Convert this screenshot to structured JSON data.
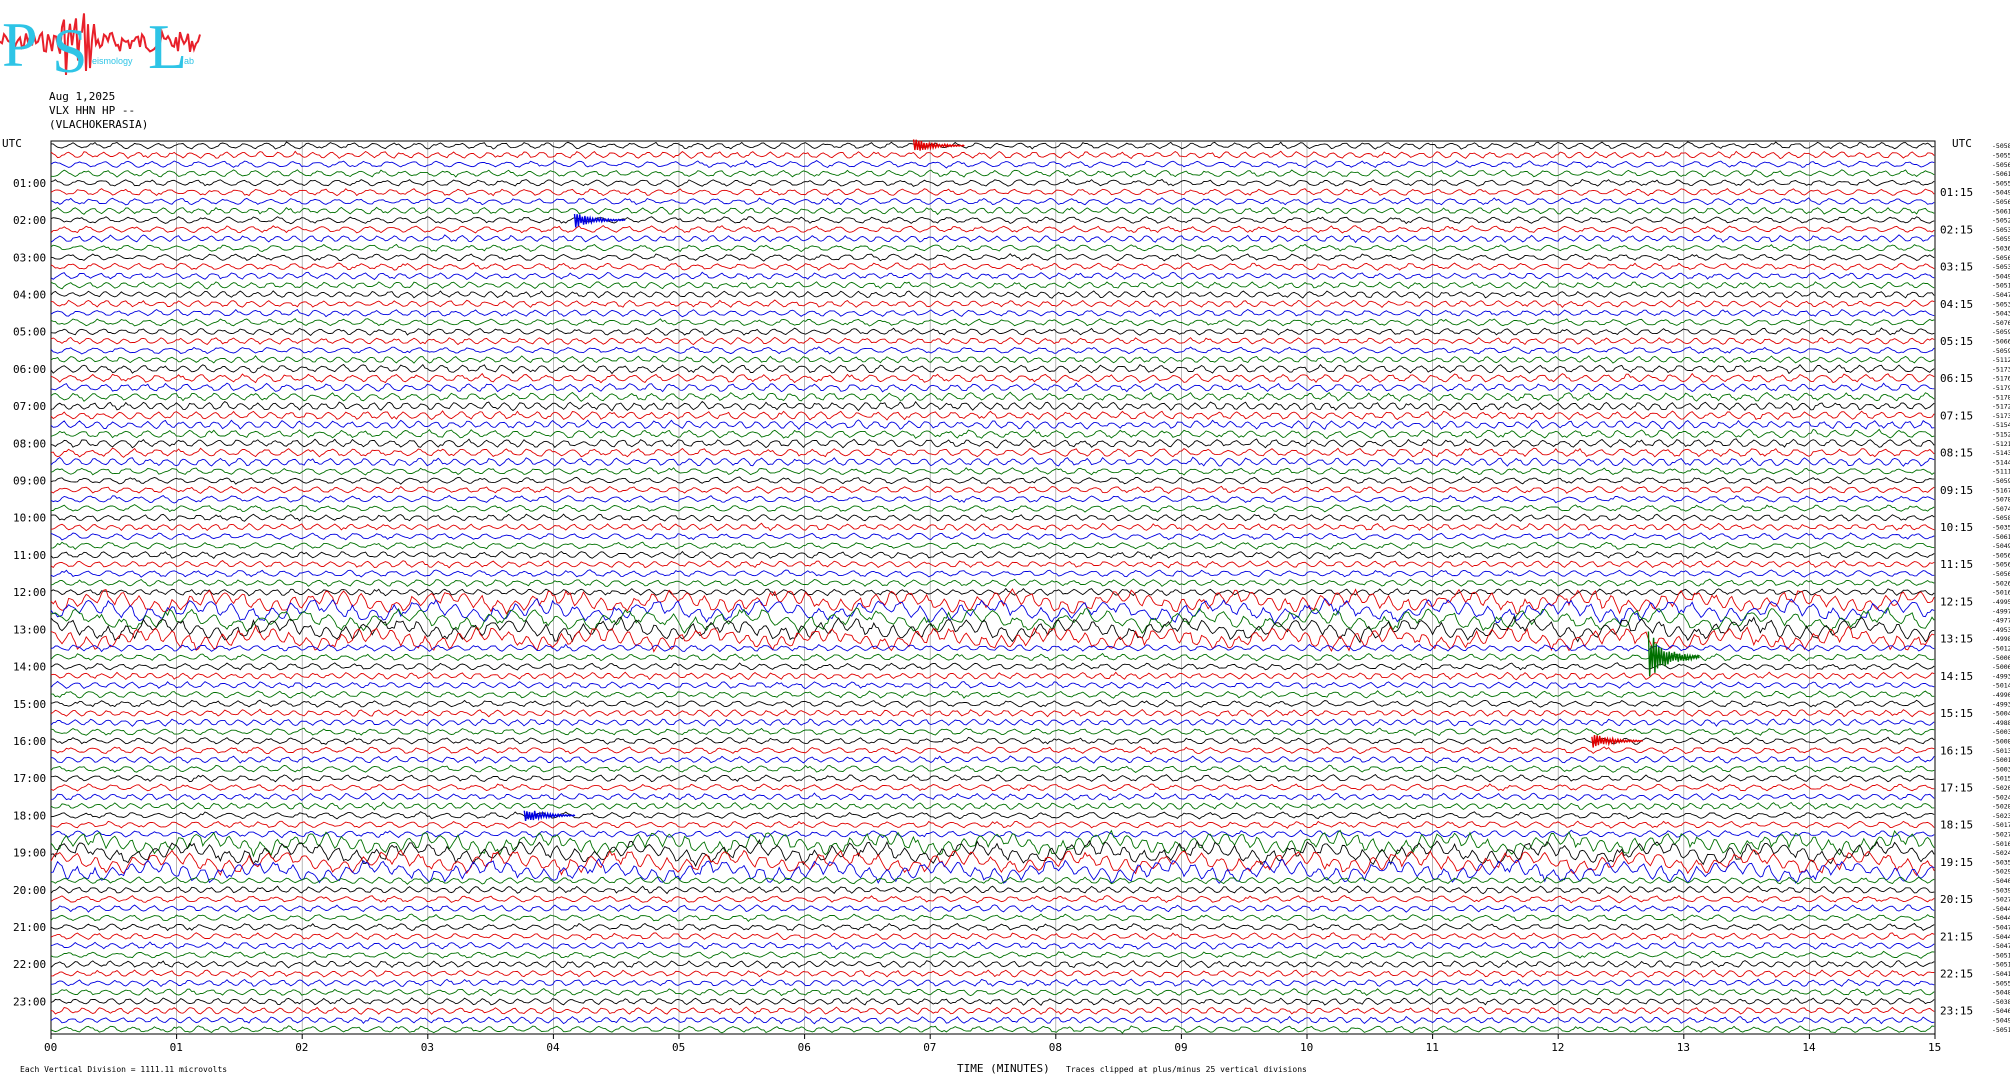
{
  "logo": {
    "letters": "PSL",
    "small_text": [
      "eismology",
      "ab"
    ],
    "colors": {
      "letters": "#2ec4e6",
      "wave": "#e8202a"
    }
  },
  "header": {
    "date": "Aug 1,2025",
    "channel": "VLX HHN HP --",
    "station": "(VLACHOKERASIA)"
  },
  "axis": {
    "left_title": "UTC",
    "right_title": "UTC",
    "left_labels": [
      "01:00",
      "02:00",
      "03:00",
      "04:00",
      "05:00",
      "06:00",
      "07:00",
      "08:00",
      "09:00",
      "10:00",
      "11:00",
      "12:00",
      "13:00",
      "14:00",
      "15:00",
      "16:00",
      "17:00",
      "18:00",
      "19:00",
      "20:00",
      "21:00",
      "22:00",
      "23:00"
    ],
    "right_labels": [
      "01:15",
      "02:15",
      "03:15",
      "04:15",
      "05:15",
      "06:15",
      "07:15",
      "08:15",
      "09:15",
      "10:15",
      "11:15",
      "12:15",
      "13:15",
      "14:15",
      "15:15",
      "16:15",
      "17:15",
      "18:15",
      "19:15",
      "20:15",
      "21:15",
      "22:15",
      "23:15"
    ],
    "x_ticks": [
      "00",
      "01",
      "02",
      "03",
      "04",
      "05",
      "06",
      "07",
      "08",
      "09",
      "10",
      "11",
      "12",
      "13",
      "14",
      "15"
    ],
    "x_title": "TIME (MINUTES)"
  },
  "footer": {
    "scale_note": "Each Vertical Division = 1111.11 microvolts",
    "clip_note": "Traces clipped at plus/minus 25 vertical divisions"
  },
  "trace_colors": [
    "#000000",
    "#e00000",
    "#0000e0",
    "#007000"
  ],
  "chart_data": {
    "type": "line",
    "title": "Aug 1,2025 VLX HHN HP -- (VLACHOKERASIA)",
    "xlabel": "TIME (MINUTES)",
    "ylabel": "UTC",
    "xlim": [
      0,
      15
    ],
    "rows": 96,
    "minutes_per_row": 15,
    "trace_colors_cycle": [
      "black",
      "red",
      "blue",
      "green"
    ],
    "row_values": [
      "-5058",
      "-5055",
      "-5056",
      "-5061",
      "-5055",
      "-5049",
      "-5056",
      "-5061",
      "-5052",
      "-5053",
      "-5055",
      "-5036",
      "-5056",
      "-5053",
      "-5049",
      "-5051",
      "-5047",
      "-5053",
      "-5043",
      "-5076",
      "-5059",
      "-5066",
      "-5059",
      "-5112",
      "-5173",
      "-5176",
      "-5179",
      "-5178",
      "-5172",
      "-5173",
      "-5154",
      "-5152",
      "-5121",
      "-5143",
      "-5144",
      "-5111",
      "-5059",
      "-5167",
      "-5078",
      "-5074",
      "-5058",
      "-5035",
      "-5061",
      "-5049",
      "-5056",
      "-5056",
      "-5056",
      "-5026",
      "-5016",
      "-4995",
      "-4997",
      "-4977",
      "-4953",
      "-4998",
      "-5012",
      "-5000",
      "-5006",
      "-4993",
      "-5014",
      "-4990",
      "-4993",
      "-5004",
      "-4988",
      "-5003",
      "-5008",
      "-5013",
      "-5001",
      "-5003",
      "-5015",
      "-5020",
      "-5024",
      "-5028",
      "-5023",
      "-5017",
      "-5027",
      "-5016",
      "-5024",
      "-5035",
      "-5029",
      "-5040",
      "-5039",
      "-5027",
      "-5044",
      "-5044",
      "-5047",
      "-5044",
      "-5047",
      "-5051",
      "-5051",
      "-5041",
      "-5055",
      "-5048",
      "-5038",
      "-5046",
      "-5049",
      "-5051"
    ],
    "events": [
      {
        "utc_row_start": "00:00",
        "minute": 6.9,
        "color": "red"
      },
      {
        "utc_row_start": "02:00",
        "minute": 4.2,
        "color": "blue"
      },
      {
        "utc_row_start": "13:45",
        "minute": 12.75,
        "color": "green"
      },
      {
        "utc_row_start": "16:00",
        "minute": 12.3,
        "color": "red"
      },
      {
        "utc_row_start": "18:00",
        "minute": 3.8,
        "color": "blue"
      }
    ]
  }
}
